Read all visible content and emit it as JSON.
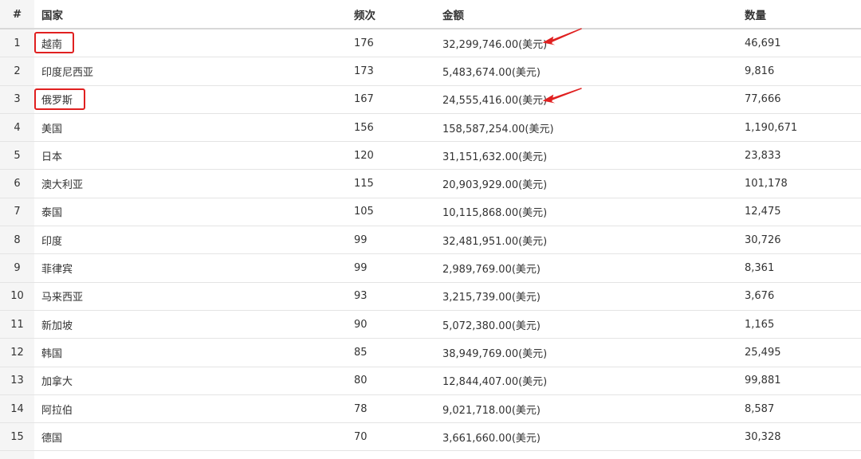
{
  "table": {
    "headers": {
      "index": "#",
      "country": "国家",
      "frequency": "频次",
      "amount": "金额",
      "quantity": "数量"
    },
    "rows": [
      {
        "index": "1",
        "country": "越南",
        "frequency": "176",
        "amount": "32,299,746.00(美元)",
        "quantity": "46,691",
        "highlighted": true,
        "arrow": true
      },
      {
        "index": "2",
        "country": "印度尼西亚",
        "frequency": "173",
        "amount": "5,483,674.00(美元)",
        "quantity": "9,816"
      },
      {
        "index": "3",
        "country": "俄罗斯",
        "frequency": "167",
        "amount": "24,555,416.00(美元)",
        "quantity": "77,666",
        "highlighted": true,
        "arrow": true
      },
      {
        "index": "4",
        "country": "美国",
        "frequency": "156",
        "amount": "158,587,254.00(美元)",
        "quantity": "1,190,671"
      },
      {
        "index": "5",
        "country": "日本",
        "frequency": "120",
        "amount": "31,151,632.00(美元)",
        "quantity": "23,833"
      },
      {
        "index": "6",
        "country": "澳大利亚",
        "frequency": "115",
        "amount": "20,903,929.00(美元)",
        "quantity": "101,178"
      },
      {
        "index": "7",
        "country": "泰国",
        "frequency": "105",
        "amount": "10,115,868.00(美元)",
        "quantity": "12,475"
      },
      {
        "index": "8",
        "country": "印度",
        "frequency": "99",
        "amount": "32,481,951.00(美元)",
        "quantity": "30,726"
      },
      {
        "index": "9",
        "country": "菲律宾",
        "frequency": "99",
        "amount": "2,989,769.00(美元)",
        "quantity": "8,361"
      },
      {
        "index": "10",
        "country": "马来西亚",
        "frequency": "93",
        "amount": "3,215,739.00(美元)",
        "quantity": "3,676"
      },
      {
        "index": "11",
        "country": "新加坡",
        "frequency": "90",
        "amount": "5,072,380.00(美元)",
        "quantity": "1,165"
      },
      {
        "index": "12",
        "country": "韩国",
        "frequency": "85",
        "amount": "38,949,769.00(美元)",
        "quantity": "25,495"
      },
      {
        "index": "13",
        "country": "加拿大",
        "frequency": "80",
        "amount": "12,844,407.00(美元)",
        "quantity": "99,881"
      },
      {
        "index": "14",
        "country": "阿拉伯",
        "frequency": "78",
        "amount": "9,021,718.00(美元)",
        "quantity": "8,587"
      },
      {
        "index": "15",
        "country": "德国",
        "frequency": "70",
        "amount": "3,661,660.00(美元)",
        "quantity": "30,328"
      }
    ]
  },
  "colors": {
    "highlight": "#e02020",
    "index_column_bg": "#f5f5f5",
    "text": "#333333"
  }
}
